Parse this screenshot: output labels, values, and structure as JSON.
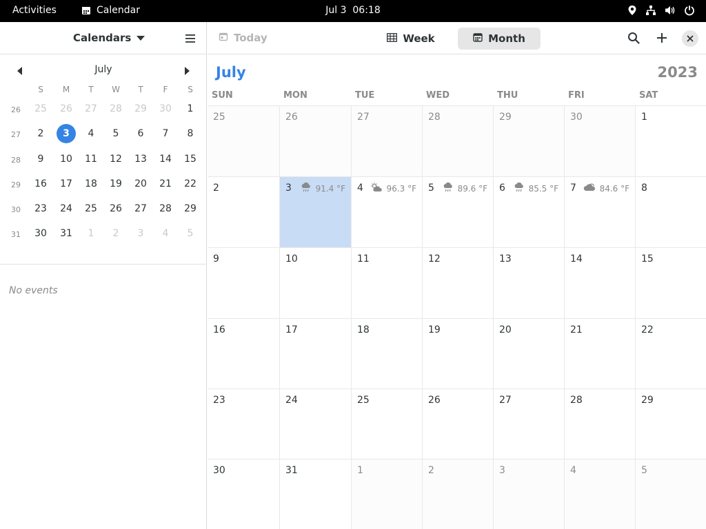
{
  "topbar": {
    "activities": "Activities",
    "app_name": "Calendar",
    "clock": "Jul 3  06:18"
  },
  "sidebar": {
    "calendars_label": "Calendars",
    "mini_month": "July",
    "weekday_heads": [
      "S",
      "M",
      "T",
      "W",
      "T",
      "F",
      "S"
    ],
    "week_numbers": [
      "26",
      "27",
      "28",
      "29",
      "30",
      "31"
    ],
    "rows": [
      [
        {
          "d": "25",
          "dim": true
        },
        {
          "d": "26",
          "dim": true
        },
        {
          "d": "27",
          "dim": true
        },
        {
          "d": "28",
          "dim": true
        },
        {
          "d": "29",
          "dim": true
        },
        {
          "d": "30",
          "dim": true
        },
        {
          "d": "1"
        }
      ],
      [
        {
          "d": "2"
        },
        {
          "d": "3",
          "selected": true
        },
        {
          "d": "4"
        },
        {
          "d": "5"
        },
        {
          "d": "6"
        },
        {
          "d": "7"
        },
        {
          "d": "8"
        }
      ],
      [
        {
          "d": "9"
        },
        {
          "d": "10"
        },
        {
          "d": "11"
        },
        {
          "d": "12"
        },
        {
          "d": "13"
        },
        {
          "d": "14"
        },
        {
          "d": "15"
        }
      ],
      [
        {
          "d": "16"
        },
        {
          "d": "17"
        },
        {
          "d": "18"
        },
        {
          "d": "19"
        },
        {
          "d": "20"
        },
        {
          "d": "21"
        },
        {
          "d": "22"
        }
      ],
      [
        {
          "d": "23"
        },
        {
          "d": "24"
        },
        {
          "d": "25"
        },
        {
          "d": "26"
        },
        {
          "d": "27"
        },
        {
          "d": "28"
        },
        {
          "d": "29"
        }
      ],
      [
        {
          "d": "30"
        },
        {
          "d": "31"
        },
        {
          "d": "1",
          "dim": true
        },
        {
          "d": "2",
          "dim": true
        },
        {
          "d": "3",
          "dim": true
        },
        {
          "d": "4",
          "dim": true
        },
        {
          "d": "5",
          "dim": true
        }
      ]
    ],
    "no_events": "No events"
  },
  "header": {
    "today_label": "Today",
    "week_label": "Week",
    "month_label": "Month",
    "active_view": "Month"
  },
  "month_view": {
    "month": "July",
    "year": "2023",
    "days_of_week": [
      "SUN",
      "MON",
      "TUE",
      "WED",
      "THU",
      "FRI",
      "SAT"
    ],
    "weeks": [
      [
        {
          "d": "25",
          "outside": true
        },
        {
          "d": "26",
          "outside": true
        },
        {
          "d": "27",
          "outside": true
        },
        {
          "d": "28",
          "outside": true
        },
        {
          "d": "29",
          "outside": true
        },
        {
          "d": "30",
          "outside": true
        },
        {
          "d": "1"
        }
      ],
      [
        {
          "d": "2"
        },
        {
          "d": "3",
          "today": true,
          "weather": "91.4 °F",
          "icon": "rain-icon"
        },
        {
          "d": "4",
          "weather": "96.3 °F",
          "icon": "partly-sunny-icon"
        },
        {
          "d": "5",
          "weather": "89.6 °F",
          "icon": "rain-icon"
        },
        {
          "d": "6",
          "weather": "85.5 °F",
          "icon": "rain-icon"
        },
        {
          "d": "7",
          "weather": "84.6 °F",
          "icon": "cloudy-icon"
        },
        {
          "d": "8"
        }
      ],
      [
        {
          "d": "9"
        },
        {
          "d": "10"
        },
        {
          "d": "11"
        },
        {
          "d": "12"
        },
        {
          "d": "13"
        },
        {
          "d": "14"
        },
        {
          "d": "15"
        }
      ],
      [
        {
          "d": "16"
        },
        {
          "d": "17"
        },
        {
          "d": "18"
        },
        {
          "d": "19"
        },
        {
          "d": "20"
        },
        {
          "d": "21"
        },
        {
          "d": "22"
        }
      ],
      [
        {
          "d": "23"
        },
        {
          "d": "24"
        },
        {
          "d": "25"
        },
        {
          "d": "26"
        },
        {
          "d": "27"
        },
        {
          "d": "28"
        },
        {
          "d": "29"
        }
      ],
      [
        {
          "d": "30"
        },
        {
          "d": "31"
        },
        {
          "d": "1",
          "outside": true
        },
        {
          "d": "2",
          "outside": true
        },
        {
          "d": "3",
          "outside": true
        },
        {
          "d": "4",
          "outside": true
        },
        {
          "d": "5",
          "outside": true
        }
      ]
    ]
  },
  "colors": {
    "accent": "#3584e4",
    "today_bg": "#c9dcf6",
    "dim_text": "#8a8a8a"
  }
}
